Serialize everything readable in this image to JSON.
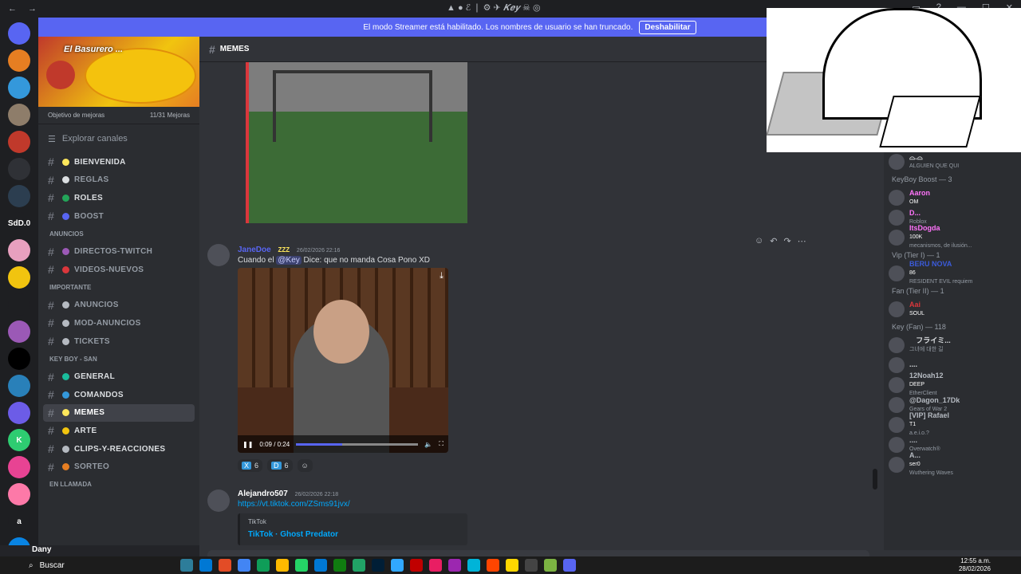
{
  "titlebar": {
    "center_text": "▲ ● ℰ ❘ ⚙ ✈ 𝑲𝒆𝒚 ☠ ◎",
    "back": "←",
    "forward": "→"
  },
  "banner": {
    "text": "El modo Streamer está habilitado. Los nombres de usuario se han truncado.",
    "button": "Deshabilitar"
  },
  "servers": [
    {
      "label": "",
      "color": "#5865f2"
    },
    {
      "label": "",
      "color": "#e67e22"
    },
    {
      "label": "",
      "color": "#3498db"
    },
    {
      "label": "",
      "color": "#8e7d6a"
    },
    {
      "label": "",
      "color": "#c0392b"
    },
    {
      "label": "",
      "color": "#2f3136"
    },
    {
      "label": "",
      "color": "#2c3e50"
    },
    {
      "label": "SdD.0",
      "color": "#1e1f22"
    },
    {
      "label": "",
      "color": "#e8a0bf"
    },
    {
      "label": "",
      "color": "#f1c40f"
    },
    {
      "label": "",
      "color": "#1e1f22"
    },
    {
      "label": "",
      "color": "#9b59b6"
    },
    {
      "label": "",
      "color": "#000000"
    },
    {
      "label": "",
      "color": "#2980b9"
    },
    {
      "label": "",
      "color": "#6c5ce7"
    },
    {
      "label": "K",
      "color": "#2ecc71"
    },
    {
      "label": "",
      "color": "#e84393"
    },
    {
      "label": "",
      "color": "#fd79a8"
    },
    {
      "label": "a",
      "color": "#1e1f22"
    },
    {
      "label": "",
      "color": "#0984e3"
    }
  ],
  "guild": {
    "name": "El Basurero ...",
    "boost_goal": "Objetivo de mejoras",
    "boost_count": "11/31 Mejoras"
  },
  "explore": "Explorar canales",
  "channels": [
    {
      "type": "ch",
      "label": "BIENVENIDA",
      "color": "#fee75c",
      "bold": true
    },
    {
      "type": "ch",
      "label": "REGLAS",
      "color": "#dbdee1",
      "dim": true
    },
    {
      "type": "ch",
      "label": "ROLES",
      "color": "#23a559",
      "bold": true
    },
    {
      "type": "ch",
      "label": "BOOST",
      "color": "#5865f2",
      "dim": true
    },
    {
      "type": "cat",
      "label": "ANUNCIOS"
    },
    {
      "type": "ch",
      "label": "DIRECTOS-TWITCH",
      "color": "#9b59b6",
      "dim": true
    },
    {
      "type": "ch",
      "label": "VIDEOS-NUEVOS",
      "color": "#da373c",
      "dim": true
    },
    {
      "type": "cat",
      "label": "IMPORTANTE"
    },
    {
      "type": "ch",
      "label": "ANUNCIOS",
      "color": "#b5bac1",
      "dim": true
    },
    {
      "type": "ch",
      "label": "MOD-ANUNCIOS",
      "color": "#b5bac1",
      "dim": true
    },
    {
      "type": "ch",
      "label": "TICKETS",
      "color": "#b5bac1",
      "dim": true
    },
    {
      "type": "cat",
      "label": "KEY BOY - SAN"
    },
    {
      "type": "ch",
      "label": "GENERAL",
      "color": "#1abc9c",
      "bold": true
    },
    {
      "type": "ch",
      "label": "COMANDOS",
      "color": "#3498db",
      "bold": true
    },
    {
      "type": "ch",
      "label": "MEMES",
      "color": "#fee75c",
      "bold": true,
      "selected": true
    },
    {
      "type": "ch",
      "label": "ARTE",
      "color": "#f1c40f",
      "bold": true
    },
    {
      "type": "ch",
      "label": "CLIPS-Y-REACCIONES",
      "color": "#b5bac1",
      "bold": true
    },
    {
      "type": "ch",
      "label": "SORTEO",
      "color": "#e67e22",
      "dim": true
    },
    {
      "type": "cat",
      "label": "EN LLAMADA"
    }
  ],
  "chat_header": {
    "channel": "MEMES"
  },
  "messages": {
    "m1": {
      "username": "JaneDoe",
      "tag": "ZZZ",
      "time": "26/02/2026 22:16",
      "text_before": "Cuando el",
      "mention": "@Key",
      "text_after": "Dice: que no manda Cosa Pono XD",
      "video_time": "0:09 / 0:24",
      "video_progress": 0.375
    },
    "reactions": [
      {
        "emoji": "X",
        "count": "6"
      },
      {
        "emoji": "D",
        "count": "6"
      }
    ],
    "m2": {
      "username": "Alejandro507",
      "time": "26/02/2026 22:18",
      "link": "https://vt.tiktok.com/ZSms91jvx/",
      "embed_provider": "TikTok",
      "embed_title": "TikTok · Ghost Predator"
    }
  },
  "members": [
    {
      "type": "mem",
      "name": "⌓.⌓",
      "sub": "ALGUIEN QUE QUI",
      "color": "#dbdee1"
    },
    {
      "type": "cat",
      "label": "KeyBoy Boost — 3"
    },
    {
      "type": "mem",
      "name": "Aaron",
      "badge": "OM",
      "color": "#ff73fa"
    },
    {
      "type": "mem",
      "name": "D...",
      "sub": "Roblox",
      "color": "#ff73fa"
    },
    {
      "type": "mem",
      "name": "ItsDogda",
      "badge": "100K",
      "sub": "mecanismos, de ilusión...",
      "color": "#ff73fa"
    },
    {
      "type": "cat",
      "label": "Vip (Tier I) — 1"
    },
    {
      "type": "mem",
      "name": "BERU NOVA",
      "badge": "86",
      "sub": "RESIDENT EVIL requiem",
      "color": "#3b5bdb"
    },
    {
      "type": "cat",
      "label": "Fan (Tier II) — 1"
    },
    {
      "type": "mem",
      "name": "Aai",
      "badge": "SOUL",
      "color": "#da373c"
    },
    {
      "type": "cat",
      "label": "Key (Fan) — 118"
    },
    {
      "type": "mem",
      "name": "ㅤフライミ...",
      "sub": "그녀에 대한 길",
      "color": "#dbdee1"
    },
    {
      "type": "mem",
      "name": "....",
      "color": "#dbdee1"
    },
    {
      "type": "mem",
      "name": "12Noah12",
      "badge": "DEEP",
      "sub": "EtherClient",
      "color": "#b5bac1"
    },
    {
      "type": "mem",
      "name": "@Dagon_17Dk",
      "sub": "Gears of War 2",
      "color": "#b5bac1"
    },
    {
      "type": "mem",
      "name": "[VIP] Rafael",
      "badge": "T1",
      "sub": "a.e.i.o.?",
      "color": "#b5bac1"
    },
    {
      "type": "mem",
      "name": "....",
      "sub": "Overwatch®",
      "color": "#b5bac1"
    },
    {
      "type": "mem",
      "name": "A...",
      "badge": "ser0",
      "sub": "Wuthering Waves",
      "color": "#b5bac1"
    }
  ],
  "user": {
    "name": "Dany"
  },
  "taskbar": {
    "search": "Buscar",
    "time": "12:55 a.m.",
    "date": "28/02/2026"
  },
  "colors": {
    "blurple": "#5865f2",
    "bg": "#313338",
    "sidebar": "#2b2d31",
    "rail": "#1e1f22"
  }
}
